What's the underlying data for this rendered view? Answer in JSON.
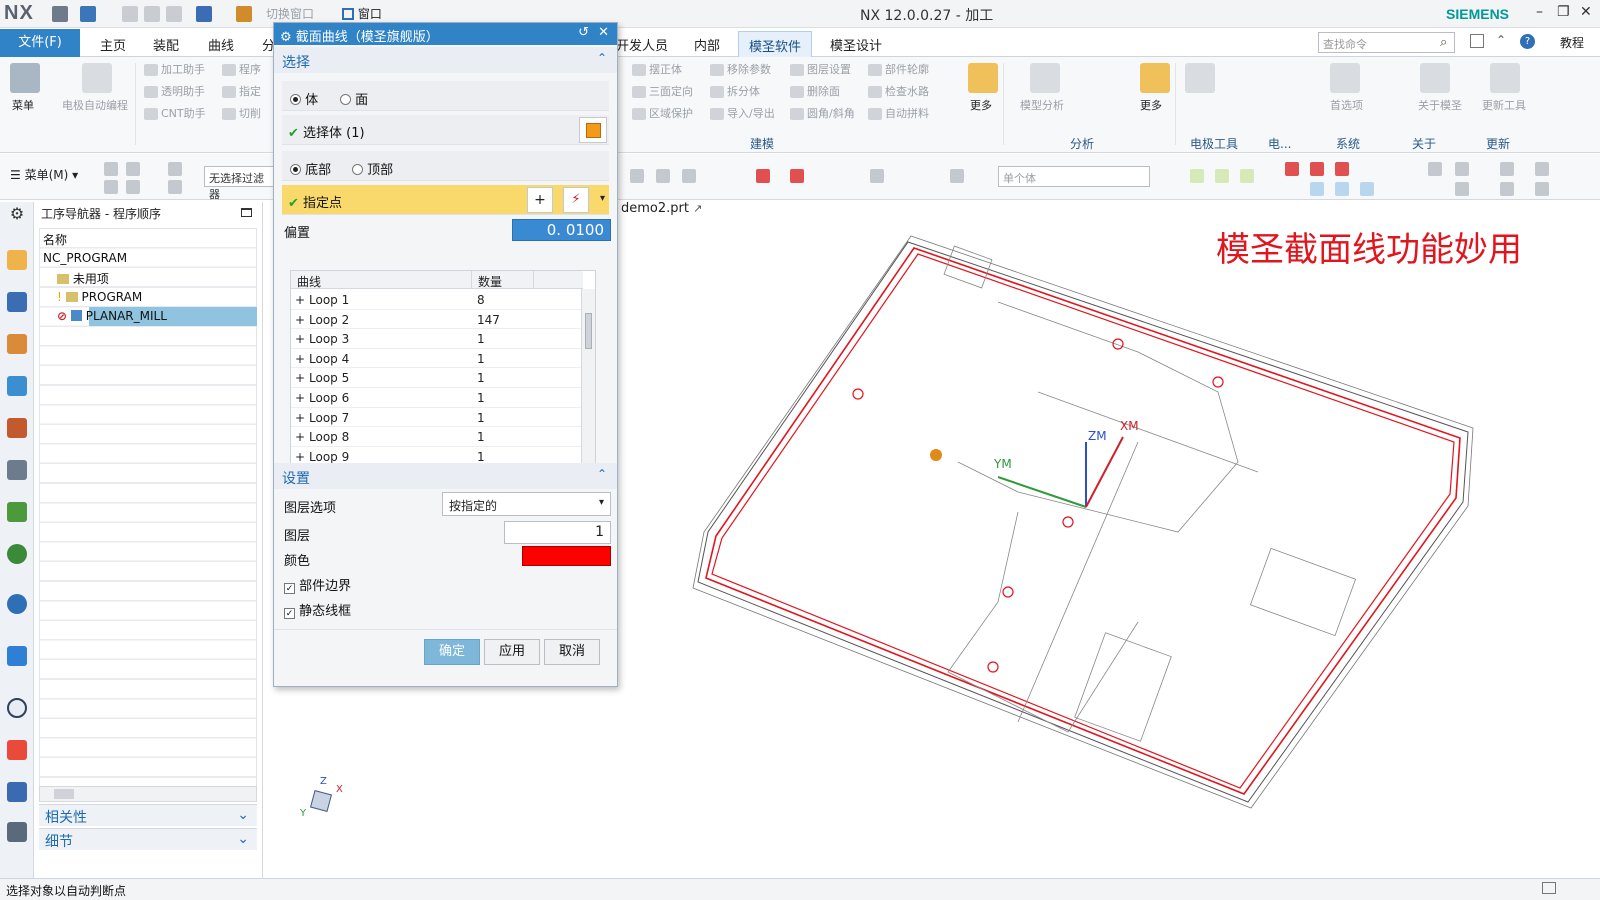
{
  "titlebar": {
    "logo": "NX",
    "quick_access": [
      "切换窗口",
      "窗口"
    ],
    "title": "NX 12.0.0.27 - 加工",
    "brand": "SIEMENS",
    "window_controls": [
      "–",
      "❐",
      "✕"
    ]
  },
  "menubar": {
    "file_tab": "文件(F)",
    "tabs": [
      "主页",
      "装配",
      "曲线",
      "分",
      "开发人员",
      "内部",
      "模圣软件",
      "模圣设计"
    ],
    "active_tab": "模圣软件",
    "search_placeholder": "查找命令",
    "tutorial": "教程"
  },
  "ribbon": {
    "menu_label": "菜单",
    "big_buttons": [
      "电极自动编程",
      "更多",
      "模型分析",
      "更多",
      "首选项",
      "关于模圣",
      "更新工具"
    ],
    "small_items": [
      "加工助手",
      "透明助手",
      "CNT助手",
      "程序",
      "指定",
      "切削",
      "摆正体",
      "三面定向",
      "区域保护",
      "移除参数",
      "拆分体",
      "导入/导出",
      "图层设置",
      "删除面",
      "圆角/斜角",
      "部件轮廓",
      "检查水路",
      "自动拼料"
    ],
    "groups": [
      "建模",
      "分析",
      "电极工具",
      "电...",
      "系统",
      "关于",
      "更新"
    ]
  },
  "toolbar": {
    "menu_button": "菜单(M)",
    "filter_box": "无选择过滤器",
    "scope_box": "单个体"
  },
  "navigator": {
    "title": "工序导航器 - 程序顺序",
    "column_header": "名称",
    "rows": [
      "NC_PROGRAM",
      "未用项",
      "PROGRAM",
      "PLANAR_MILL"
    ],
    "sections": [
      "相关性",
      "细节"
    ]
  },
  "dialog": {
    "title": "截面曲线（模圣旗舰版）",
    "select_section": "选择",
    "radio_body": "体",
    "radio_face": "面",
    "select_body": "选择体 (1)",
    "radio_bottom": "底部",
    "radio_top": "顶部",
    "specify_point": "指定点",
    "offset_label": "偏置",
    "offset_value": "0. 0100",
    "grid_headers": [
      "曲线",
      "数量"
    ],
    "loops": [
      {
        "name": "Loop 1",
        "count": "8"
      },
      {
        "name": "Loop 2",
        "count": "147"
      },
      {
        "name": "Loop 3",
        "count": "1"
      },
      {
        "name": "Loop 4",
        "count": "1"
      },
      {
        "name": "Loop 5",
        "count": "1"
      },
      {
        "name": "Loop 6",
        "count": "1"
      },
      {
        "name": "Loop 7",
        "count": "1"
      },
      {
        "name": "Loop 8",
        "count": "1"
      },
      {
        "name": "Loop 9",
        "count": "1"
      }
    ],
    "settings_section": "设置",
    "layer_option_label": "图层选项",
    "layer_option_value": "按指定的",
    "layer_label": "图层",
    "layer_value": "1",
    "color_label": "颜色",
    "color_value": "#ff0000",
    "part_boundary": "部件边界",
    "static_wireframe": "静态线框",
    "ok": "确定",
    "apply": "应用",
    "cancel": "取消"
  },
  "viewport": {
    "tab": "demo2.prt",
    "banner": "模圣截面线功能妙用",
    "axes": {
      "zm": "ZM",
      "ym": "YM",
      "xm": "XM"
    },
    "triad": {
      "x": "X",
      "y": "Y",
      "z": "Z"
    }
  },
  "status": "选择对象以自动判断点",
  "colors": {
    "accent": "#2f83c6",
    "highlight": "#f9d96b",
    "section_curve": "#e0151d",
    "selection": "#8fc3e0"
  }
}
